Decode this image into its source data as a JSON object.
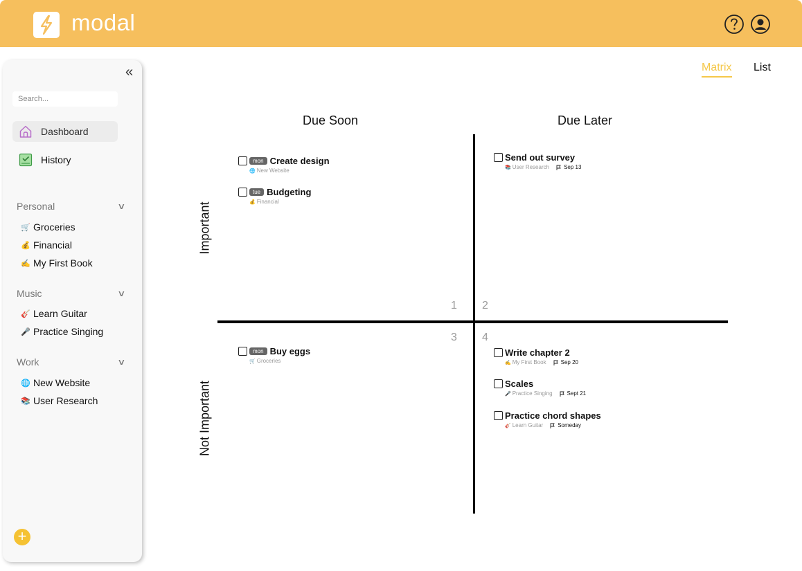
{
  "app": {
    "name": "modal"
  },
  "sidebar": {
    "search_placeholder": "Search...",
    "nav": {
      "dashboard": "Dashboard",
      "history": "History"
    },
    "sections": [
      {
        "title": "Personal",
        "projects": [
          {
            "label": "Groceries",
            "icon": "🛒"
          },
          {
            "label": "Financial",
            "icon": "💰"
          },
          {
            "label": "My First Book",
            "icon": "✍"
          }
        ]
      },
      {
        "title": "Music",
        "projects": [
          {
            "label": "Learn Guitar",
            "icon": "🎸"
          },
          {
            "label": "Practice Singing",
            "icon": "🎤"
          }
        ]
      },
      {
        "title": "Work",
        "projects": [
          {
            "label": "New Website",
            "icon": "🌐"
          },
          {
            "label": "User Research",
            "icon": "📚"
          }
        ]
      }
    ]
  },
  "tabs": {
    "matrix": "Matrix",
    "list": "List"
  },
  "matrix": {
    "col_due_soon": "Due Soon",
    "col_due_later": "Due Later",
    "row_important": "Important",
    "row_not_important": "Not Important",
    "quadrants": [
      "1",
      "2",
      "3",
      "4"
    ],
    "tasks": [
      {
        "title": "Create design",
        "day": "mon",
        "project": "New Website",
        "project_icon": "🌐"
      },
      {
        "title": "Budgeting",
        "day": "tue",
        "project": "Financial",
        "project_icon": "💰"
      },
      {
        "title": "Send out survey",
        "project": "User Research",
        "project_icon": "📚",
        "due": "Sep 13"
      },
      {
        "title": "Buy eggs",
        "day": "mon",
        "project": "Groceries",
        "project_icon": "🛒"
      },
      {
        "title": "Write chapter 2",
        "project": "My First Book",
        "project_icon": "✍",
        "due": "Sep 20"
      },
      {
        "title": "Scales",
        "project": "Practice Singing",
        "project_icon": "🎤",
        "due": "Sept 21"
      },
      {
        "title": "Practice chord shapes",
        "project": "Learn Guitar",
        "project_icon": "🎸",
        "due": "Someday"
      }
    ]
  },
  "colors": {
    "header": "#f6bf5d",
    "accent": "#f5c84a",
    "add_button": "#f5c233"
  }
}
